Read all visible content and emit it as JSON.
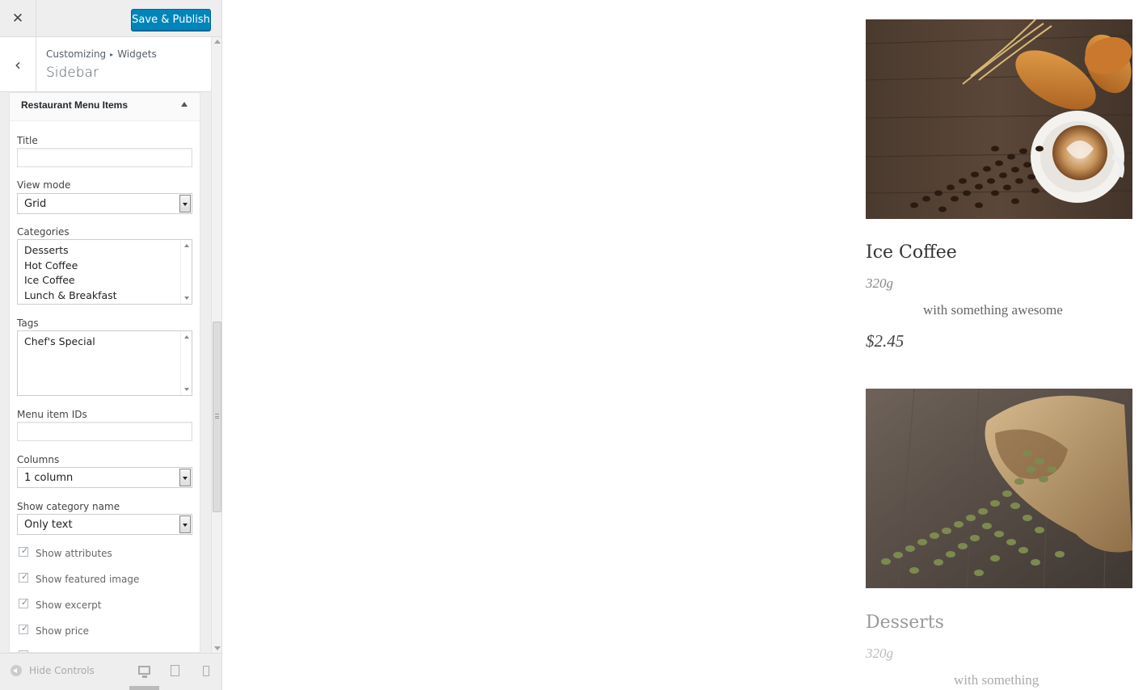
{
  "toolbar": {
    "close_icon": "close-icon",
    "publish_label": "Save & Publish"
  },
  "header": {
    "breadcrumb": [
      "Customizing",
      "Widgets"
    ],
    "breadcrumb_separator": "▸",
    "title": "Sidebar"
  },
  "widget": {
    "title": "Restaurant Menu Items",
    "fields": {
      "title_label": "Title",
      "title_value": "",
      "view_mode_label": "View mode",
      "view_mode_value": "Grid",
      "categories_label": "Categories",
      "categories": [
        "Desserts",
        "Hot Coffee",
        "Ice Coffee",
        "Lunch & Breakfast"
      ],
      "tags_label": "Tags",
      "tags": [
        "Chef's Special"
      ],
      "menu_ids_label": "Menu item IDs",
      "menu_ids_value": "",
      "columns_label": "Columns",
      "columns_value": "1 column",
      "show_category_label": "Show category name",
      "show_category_value": "Only text"
    },
    "checkboxes": [
      {
        "label": "Show attributes",
        "checked": true
      },
      {
        "label": "Show featured image",
        "checked": true
      },
      {
        "label": "Show excerpt",
        "checked": true
      },
      {
        "label": "Show price",
        "checked": true
      }
    ]
  },
  "footer": {
    "hide_controls_label": "Hide Controls",
    "active_device": "desktop"
  },
  "preview": {
    "items": [
      {
        "title": "Ice Coffee",
        "weight": "320g",
        "description": "with something awesome",
        "price": "$2.45"
      },
      {
        "title": "Desserts",
        "weight": "320g",
        "description": "with something"
      }
    ]
  },
  "colors": {
    "accent": "#0085ba",
    "panel_bg": "#eeeeee"
  }
}
